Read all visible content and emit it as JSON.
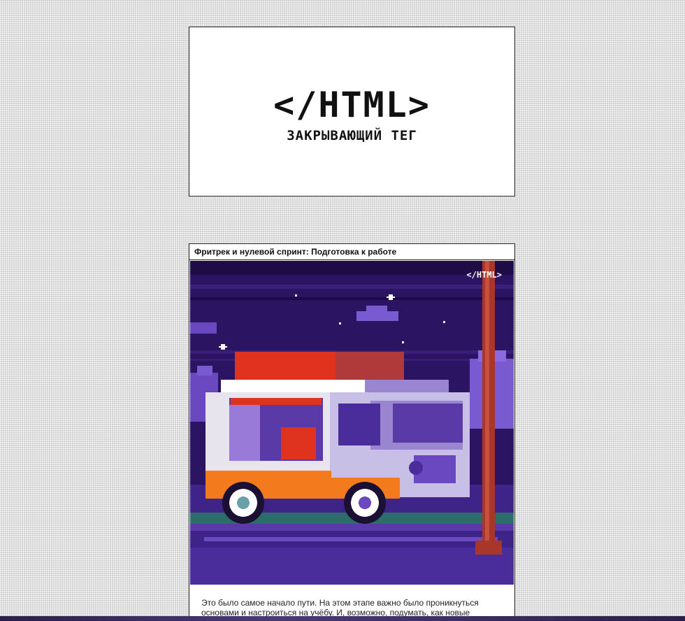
{
  "logo": {
    "title": "</HTML>",
    "subtitle": "ЗАКРЫВАЮЩИЙ ТЕГ"
  },
  "post": {
    "title": "Фритрек и нулевой спринт: Подготовка к работе",
    "image_watermark": "</HTML>",
    "text": "Это было самое начало пути. На этом этапе важно было проникнуться основами и настроиться на учёбу. И, возможно, подумать, как новые"
  },
  "colors": {
    "sky": "#2a1260",
    "van_roof": "#e0331f",
    "van_body": "#e8e4ee",
    "accent_orange": "#f47a1e",
    "pole": "#a8362a"
  }
}
